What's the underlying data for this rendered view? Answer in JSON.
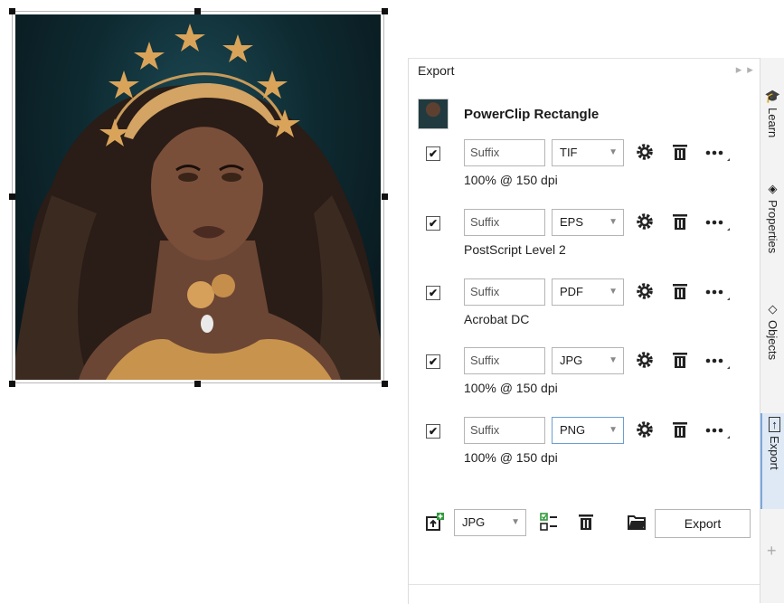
{
  "docker": {
    "title": "Export",
    "controls": "▸▸ ×",
    "object_name": "PowerClip Rectangle",
    "rows": [
      {
        "checked": "✔",
        "suffix_placeholder": "Suffix",
        "format": "TIF",
        "desc": "100% @ 150 dpi"
      },
      {
        "checked": "✔",
        "suffix_placeholder": "Suffix",
        "format": "EPS",
        "desc": "PostScript Level 2"
      },
      {
        "checked": "✔",
        "suffix_placeholder": "Suffix",
        "format": "PDF",
        "desc": "Acrobat DC"
      },
      {
        "checked": "✔",
        "suffix_placeholder": "Suffix",
        "format": "JPG",
        "desc": "100% @ 150 dpi"
      },
      {
        "checked": "✔",
        "suffix_placeholder": "Suffix",
        "format": "PNG",
        "desc": "100% @ 150 dpi"
      }
    ],
    "bottom": {
      "format": "JPG",
      "export_label": "Export"
    }
  },
  "side_tabs": [
    {
      "label": "Learn",
      "icon": "learn-icon"
    },
    {
      "label": "Properties",
      "icon": "properties-icon"
    },
    {
      "label": "Objects",
      "icon": "objects-icon"
    },
    {
      "label": "Export",
      "icon": "export-icon"
    }
  ],
  "colors": {
    "accent": "#6a9fd2",
    "gold": "#d9a45a",
    "bg_teal": "#0e2a31"
  }
}
